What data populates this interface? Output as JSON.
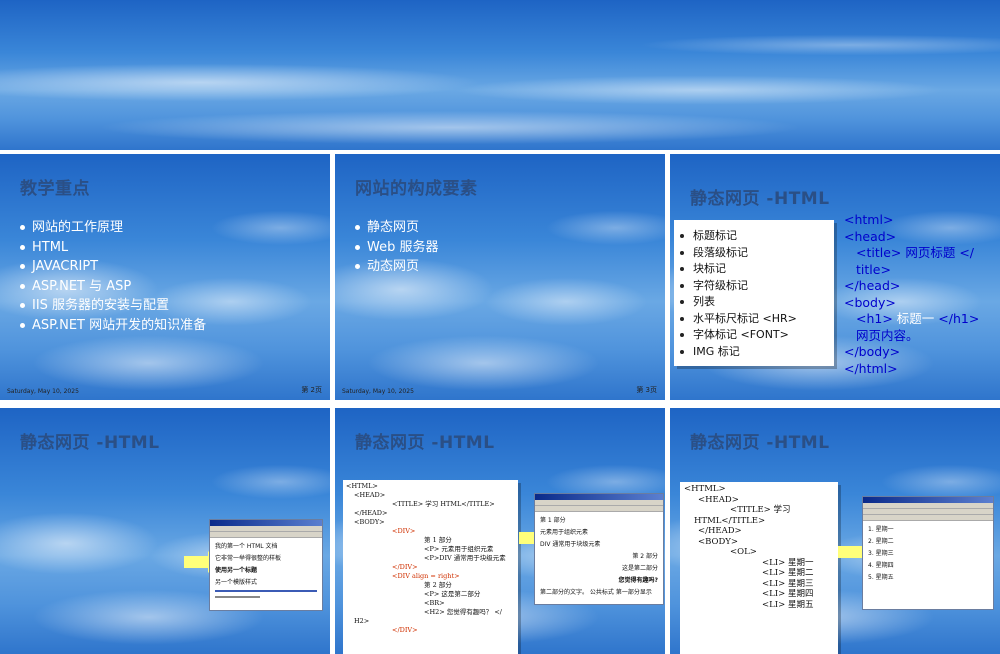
{
  "slide2": {
    "title": "教学重点",
    "bullets": [
      "网站的工作原理",
      "HTML",
      "JAVACRIPT",
      "ASP.NET 与 ASP",
      "IIS 服务器的安装与配置",
      "ASP.NET 网站开发的知识准备"
    ],
    "date": "Saturday, May 10, 2025",
    "page": "第 2页"
  },
  "slide3": {
    "title": "网站的构成要素",
    "bullets": [
      "静态网页",
      "Web 服务器",
      "动态网页"
    ],
    "date": "Saturday, May 10, 2025",
    "page": "第 3页"
  },
  "slide4": {
    "title": "静态网页 -HTML",
    "box_items": [
      "标题标记",
      "段落级标记",
      "块标记",
      "字符级标记",
      "列表",
      "水平标尺标记 <HR>",
      "字体标记  <FONT>",
      "IMG  标记"
    ],
    "code": {
      "l1": "<html>",
      "l2": "<head>",
      "l3a": "<title>",
      "l3b": " 网页标题 </",
      "l3c": "title>",
      "l4": "</head>",
      "l5": "<body>",
      "l6a": "<h1>",
      "l6b": " 标题一 ",
      "l6c": "</h1>",
      "l7": "网页内容。",
      "l8": "</body>",
      "l9": "</html>"
    }
  },
  "slide5": {
    "title": "静态网页 -HTML",
    "browser_lines": [
      "我的第一个 HTML 文档",
      "它非常一举得很整的样板",
      "使用另一个标题",
      "另一个模版样式"
    ]
  },
  "slide6": {
    "title": "静态网页 -HTML",
    "code_lines": {
      "a": "<HTML>",
      "b": "<HEAD>",
      "c": "<TITLE> 学习 HTML</TITLE>",
      "d": "</HEAD>",
      "e": "<BODY>",
      "f": "<DIV>",
      "g": "第 1 部分",
      "h": "<P> 元素用于组织元素",
      "i": "<P>DIV 通常用于块级元素",
      "j": "</DIV>",
      "k": "<DIV align = right>",
      "l": "第 2 部分",
      "m": "<P> 这是第二部分",
      "n": "<BR>",
      "o": "<H2> 您觉得有趣吗？ </",
      "p": "H2>",
      "q": "</DIV>"
    },
    "browser_lines": [
      "第 1 部分",
      "元素用于组织元素",
      "DIV 通常用于块级元素",
      "第 2 部分",
      "这是第二部分",
      "您觉得有趣吗?",
      "第二部分的文字。  公共标式 第一部分显示"
    ]
  },
  "slide7": {
    "title": "静态网页 -HTML",
    "code_lines": {
      "a": "<HTML>",
      "b": "<HEAD>",
      "c": "<TITLE> 学习",
      "d": "HTML</TITLE>",
      "e": "</HEAD>",
      "f": "<BODY>",
      "g": "<OL>",
      "h": "<LI> 星期一",
      "i": "<LI> 星期二",
      "j": "<LI> 星期三",
      "k": "<LI> 星期四",
      "l": "<LI> 星期五"
    },
    "browser_lines": [
      "1.  星期一",
      "2.  星期二",
      "3.  星期三",
      "4.  星期四",
      "5.  星期五"
    ]
  }
}
